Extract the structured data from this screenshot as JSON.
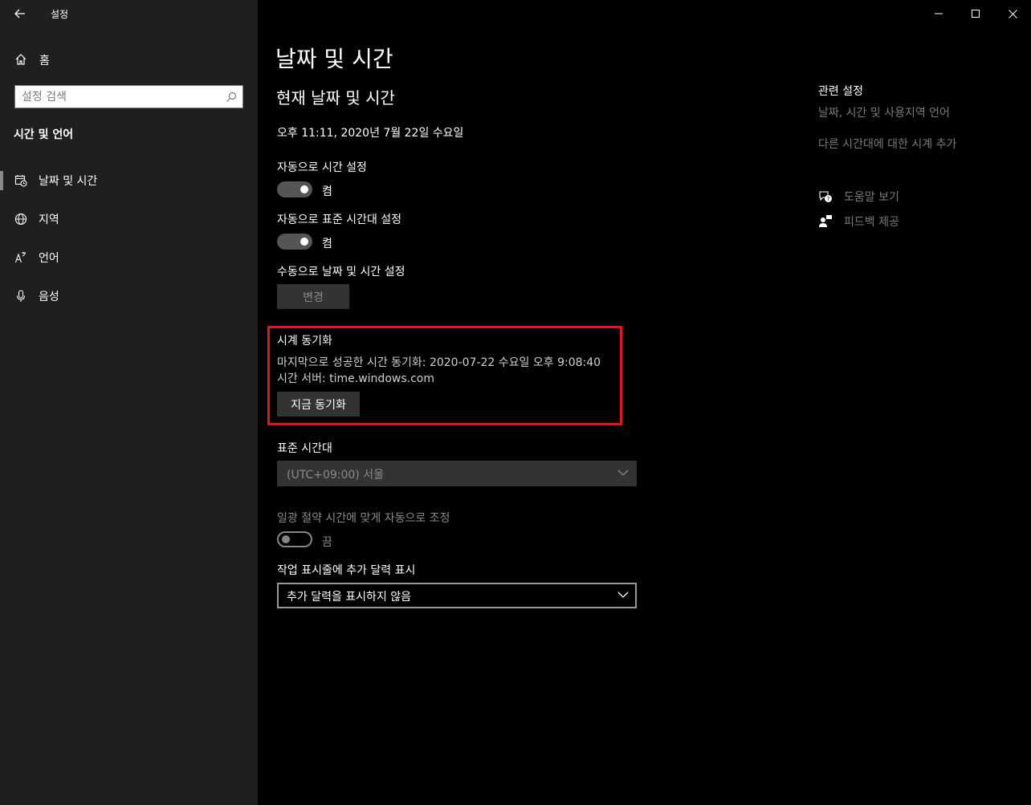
{
  "window": {
    "app_title": "설정",
    "back_icon": "arrow-left-icon",
    "controls": [
      "minimize-icon",
      "maximize-icon",
      "close-icon"
    ]
  },
  "sidebar": {
    "home_label": "홈",
    "search_placeholder": "설정 검색",
    "section_heading": "시간 및 언어",
    "items": [
      {
        "label": "날짜 및 시간",
        "icon": "calendar-clock-icon",
        "selected": true
      },
      {
        "label": "지역",
        "icon": "globe-icon",
        "selected": false
      },
      {
        "label": "언어",
        "icon": "language-icon",
        "selected": false
      },
      {
        "label": "음성",
        "icon": "microphone-icon",
        "selected": false
      }
    ]
  },
  "main": {
    "page_title": "날짜 및 시간",
    "sub_title": "현재 날짜 및 시간",
    "current_datetime": "오후 11:11, 2020년 7월 22일 수요일",
    "auto_time": {
      "label": "자동으로 시간 설정",
      "state": "켬",
      "on": true
    },
    "auto_timezone": {
      "label": "자동으로 표준 시간대 설정",
      "state": "켬",
      "on": true
    },
    "manual_set": {
      "label": "수동으로 날짜 및 시간 설정",
      "button": "변경"
    },
    "sync": {
      "title": "시계 동기화",
      "last_sync": "마지막으로 성공한 시간 동기화: 2020-07-22 수요일 오후 9:08:40",
      "server": "시간 서버: time.windows.com",
      "button": "지금 동기화",
      "highlight_color": "#e3141e"
    },
    "timezone": {
      "label": "표준 시간대",
      "value": "(UTC+09:00) 서울"
    },
    "dst": {
      "label": "일광 절약 시간에 맞게 자동으로 조정",
      "state": "끔",
      "on": false
    },
    "calendar": {
      "label": "작업 표시줄에 추가 달력 표시",
      "value": "추가 달력을 표시하지 않음"
    }
  },
  "related": {
    "title": "관련 설정",
    "links": [
      "날짜, 시간 및 사용지역 언어",
      "다른 시간대에 대한 시계 추가"
    ],
    "help": {
      "label": "도움말 보기",
      "icon": "help-chat-icon"
    },
    "feedback": {
      "label": "피드백 제공",
      "icon": "feedback-icon"
    }
  }
}
